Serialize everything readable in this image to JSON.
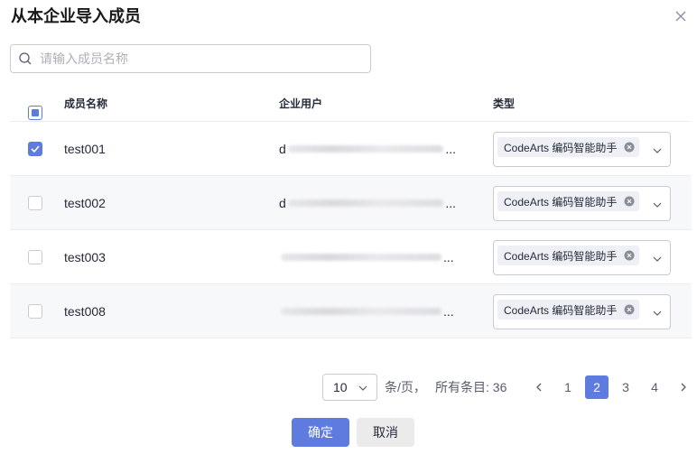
{
  "dialog": {
    "title": "从本企业导入成员",
    "close_icon": "close-icon"
  },
  "search": {
    "placeholder": "请输入成员名称",
    "value": ""
  },
  "table": {
    "headers": {
      "name": "成员名称",
      "user": "企业用户",
      "type": "类型"
    },
    "select_all_state": "indeterminate",
    "rows": [
      {
        "checked": true,
        "name": "test001",
        "user_prefix": "d",
        "user_suffix": "...",
        "type_tag": "CodeArts 编码智能助手"
      },
      {
        "checked": false,
        "name": "test002",
        "user_prefix": "d",
        "user_suffix": "...",
        "type_tag": "CodeArts 编码智能助手"
      },
      {
        "checked": false,
        "name": "test003",
        "user_prefix": "",
        "user_suffix": "...",
        "type_tag": "CodeArts 编码智能助手"
      },
      {
        "checked": false,
        "name": "test008",
        "user_prefix": "",
        "user_suffix": "...",
        "type_tag": "CodeArts 编码智能助手"
      }
    ]
  },
  "pagination": {
    "page_size": "10",
    "per_page_label": "条/页，",
    "total_label": "所有条目: 36",
    "pages": [
      "1",
      "2",
      "3",
      "4"
    ],
    "current_page": "2"
  },
  "footer": {
    "confirm_label": "确定",
    "cancel_label": "取消"
  },
  "colors": {
    "primary": "#5e7ce0",
    "text": "#252b3a",
    "border": "#c9ccd2",
    "stripe": "#f7f8fa"
  }
}
